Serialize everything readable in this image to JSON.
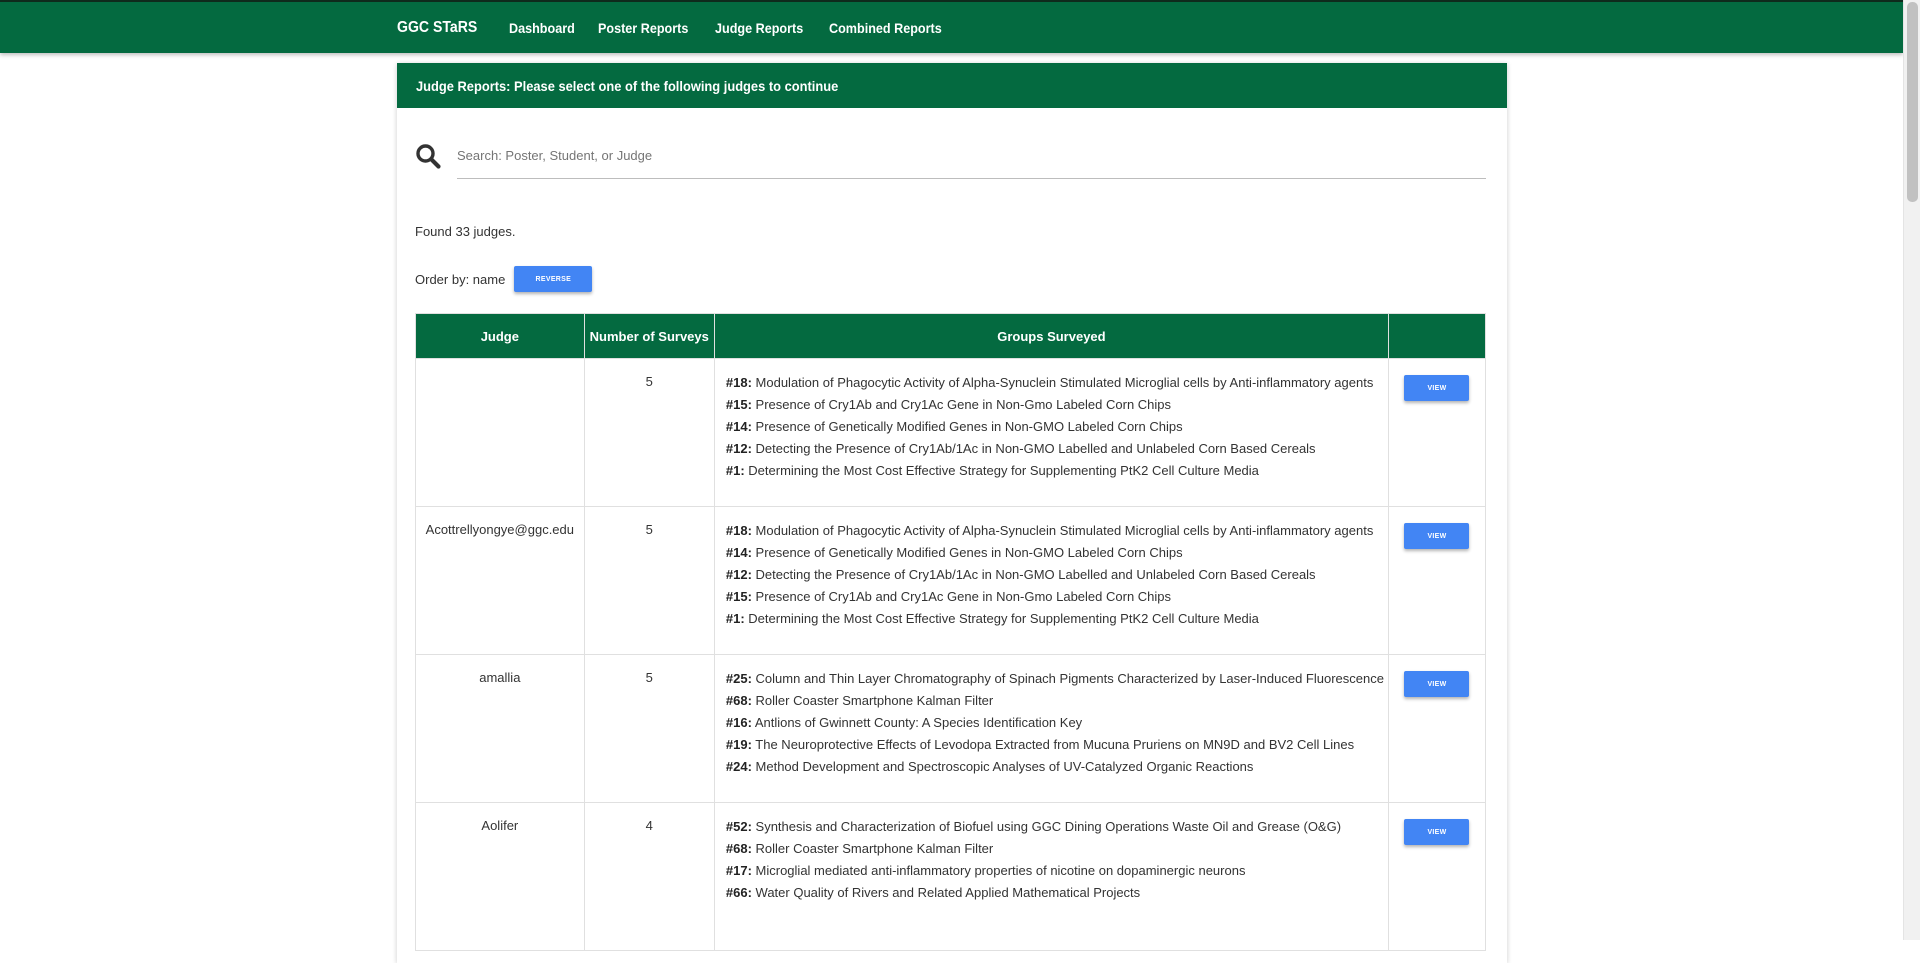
{
  "nav": {
    "brand": "GGC STaRS",
    "links": [
      "Dashboard",
      "Poster Reports",
      "Judge Reports",
      "Combined Reports"
    ]
  },
  "card": {
    "header": "Judge Reports: Please select one of the following judges to continue"
  },
  "search": {
    "placeholder": "Search: Poster, Student, or Judge",
    "value": ""
  },
  "found_text": "Found 33 judges.",
  "order_by": {
    "label": "Order by: name",
    "reverse_label": "REVERSE"
  },
  "table": {
    "headers": [
      "Judge",
      "Number of Surveys",
      "Groups Surveyed",
      ""
    ],
    "view_label": "VIEW",
    "rows": [
      {
        "judge": "",
        "count": "5",
        "groups": [
          {
            "num": "#18:",
            "title": "Modulation of Phagocytic Activity of Alpha-Synuclein Stimulated Microglial cells by Anti-inflammatory agents"
          },
          {
            "num": "#15:",
            "title": "Presence of Cry1Ab and Cry1Ac Gene in Non-Gmo Labeled Corn Chips"
          },
          {
            "num": "#14:",
            "title": "Presence of Genetically Modified Genes in Non-GMO Labeled Corn Chips"
          },
          {
            "num": "#12:",
            "title": "Detecting the Presence of Cry1Ab/1Ac in Non-GMO Labelled and Unlabeled Corn Based Cereals"
          },
          {
            "num": "#1:",
            "title": "Determining the Most Cost Effective Strategy for Supplementing PtK2 Cell Culture Media"
          }
        ]
      },
      {
        "judge": "Acottrellyongye@ggc.edu",
        "count": "5",
        "groups": [
          {
            "num": "#18:",
            "title": "Modulation of Phagocytic Activity of Alpha-Synuclein Stimulated Microglial cells by Anti-inflammatory agents"
          },
          {
            "num": "#14:",
            "title": "Presence of Genetically Modified Genes in Non-GMO Labeled Corn Chips"
          },
          {
            "num": "#12:",
            "title": "Detecting the Presence of Cry1Ab/1Ac in Non-GMO Labelled and Unlabeled Corn Based Cereals"
          },
          {
            "num": "#15:",
            "title": "Presence of Cry1Ab and Cry1Ac Gene in Non-Gmo Labeled Corn Chips"
          },
          {
            "num": "#1:",
            "title": "Determining the Most Cost Effective Strategy for Supplementing PtK2 Cell Culture Media"
          }
        ]
      },
      {
        "judge": "amallia",
        "count": "5",
        "groups": [
          {
            "num": "#25:",
            "title": "Column and Thin Layer Chromatography of Spinach Pigments Characterized by Laser-Induced Fluorescence"
          },
          {
            "num": "#68:",
            "title": "Roller Coaster Smartphone Kalman Filter"
          },
          {
            "num": "#16:",
            "title": "Antlions of Gwinnett County: A Species Identification Key"
          },
          {
            "num": "#19:",
            "title": "The Neuroprotective Effects of Levodopa Extracted from Mucuna Pruriens on MN9D and BV2 Cell Lines"
          },
          {
            "num": "#24:",
            "title": "Method Development and Spectroscopic Analyses of UV-Catalyzed Organic Reactions"
          }
        ]
      },
      {
        "judge": "Aolifer",
        "count": "4",
        "groups": [
          {
            "num": "#52:",
            "title": "Synthesis and Characterization of Biofuel using GGC Dining Operations Waste Oil and Grease (O&G)"
          },
          {
            "num": "#68:",
            "title": "Roller Coaster Smartphone Kalman Filter"
          },
          {
            "num": "#17:",
            "title": "Microglial mediated anti-inflammatory properties of nicotine on dopaminergic neurons"
          },
          {
            "num": "#66:",
            "title": "Water Quality of Rivers and Related Applied Mathematical Projects"
          }
        ]
      }
    ]
  }
}
